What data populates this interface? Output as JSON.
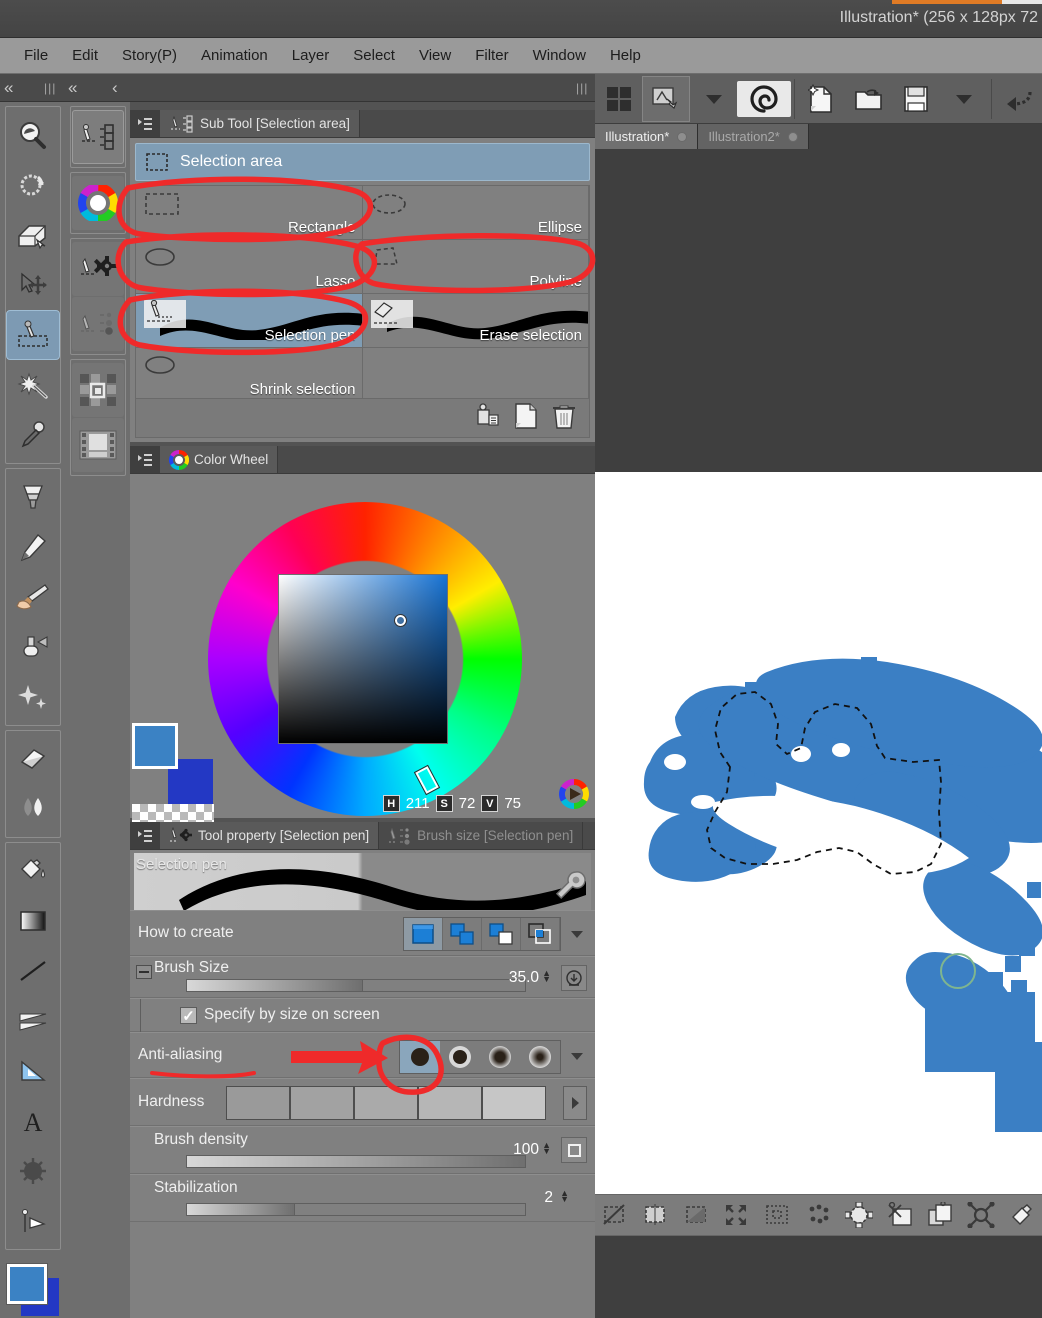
{
  "window": {
    "title": "Illustration* (256 x 128px 72"
  },
  "menu": {
    "items": [
      "File",
      "Edit",
      "Story(P)",
      "Animation",
      "Layer",
      "Select",
      "View",
      "Filter",
      "Window",
      "Help"
    ]
  },
  "toolbar": {
    "buttons": [
      {
        "name": "grid-view-icon",
        "label": ""
      },
      {
        "name": "tool-switch-icon",
        "label": ""
      },
      {
        "name": "chevron-down-icon",
        "label": ""
      },
      {
        "name": "clip-studio-logo-icon",
        "label": ""
      },
      {
        "name": "new-file-icon",
        "label": ""
      },
      {
        "name": "open-file-icon",
        "label": ""
      },
      {
        "name": "save-icon",
        "label": ""
      },
      {
        "name": "chevron-down-icon-2",
        "label": ""
      },
      {
        "name": "undo-icon",
        "label": ""
      }
    ]
  },
  "document_tabs": [
    {
      "label": "Illustration*",
      "active": true
    },
    {
      "label": "Illustration2*",
      "active": false
    }
  ],
  "tool_palette": {
    "groups": [
      [
        "magnifier-tool",
        "rotate-tool",
        "move-tool",
        "object-select-tool",
        "selection-area-tool",
        "magic-wand-tool",
        "eyedropper-tool"
      ],
      [
        "fill-gradient-tool",
        "pen-tool",
        "brush-tool",
        "airbrush-tool",
        "decoration-tool"
      ],
      [
        "eraser-tool",
        "blend-tool"
      ],
      [
        "paint-bucket-tool",
        "gradient-tool",
        "line-tool",
        "figure-tool",
        "ruler-tool",
        "text-tool",
        "balloon-tool",
        "frame-border-tool"
      ]
    ],
    "selected": "selection-area-tool"
  },
  "palette_icons": {
    "items": [
      "sub-tool-palette-icon",
      "color-wheel-palette-icon",
      "tool-property-palette-icon",
      "brush-size-palette-icon",
      "material-palette-icon",
      "timeline-palette-icon"
    ]
  },
  "sub_tool_panel": {
    "tab_label": "Sub Tool [Selection area]",
    "group_header": "Selection area",
    "tools": [
      {
        "label": "Rectangle",
        "icon": "rectangle-select-icon",
        "selected": false
      },
      {
        "label": "Ellipse",
        "icon": "ellipse-select-icon",
        "selected": false
      },
      {
        "label": "Lasso",
        "icon": "lasso-select-icon",
        "selected": false
      },
      {
        "label": "Polyline",
        "icon": "polyline-select-icon",
        "selected": false
      },
      {
        "label": "Selection pen",
        "icon": "selection-pen-icon",
        "selected": true
      },
      {
        "label": "Erase selection",
        "icon": "erase-selection-icon",
        "selected": false
      },
      {
        "label": "Shrink selection",
        "icon": "shrink-selection-icon",
        "selected": false
      }
    ],
    "footer_buttons": [
      "duplicate-sub-tool-icon",
      "create-sub-tool-icon",
      "delete-sub-tool-icon"
    ]
  },
  "color_wheel_panel": {
    "tab_label": "Color Wheel",
    "hsv": {
      "h_key": "H",
      "h": "211",
      "s_key": "S",
      "s": "72",
      "v_key": "V",
      "v": "75"
    },
    "colors": {
      "foreground": "#3b82c4",
      "background": "#2338c4"
    }
  },
  "tool_property_panel": {
    "tab_label": "Tool property [Selection pen]",
    "tab_label_inactive": "Brush size [Selection pen]",
    "preview_name": "Selection pen",
    "rows": {
      "how_to_create": {
        "label": "How to create",
        "modes": [
          "create-selection-mode",
          "add-selection-mode",
          "subtract-selection-mode",
          "intersect-selection-mode"
        ],
        "selected_index": 0
      },
      "brush_size": {
        "label": "Brush Size",
        "value": "35.0",
        "fill_percent": 52
      },
      "specify_by_size": {
        "label": "Specify by size on screen",
        "checked": true
      },
      "anti_aliasing": {
        "label": "Anti-aliasing",
        "options": [
          "none",
          "low",
          "medium",
          "high"
        ],
        "selected_index": 0
      },
      "hardness": {
        "label": "Hardness",
        "swatches": 5
      },
      "brush_density": {
        "label": "Brush density",
        "value": "100",
        "fill_percent": 100
      },
      "stabilization": {
        "label": "Stabilization",
        "value": "2",
        "fill_percent": 32
      }
    }
  },
  "selection_launcher": {
    "buttons": [
      "deselect-icon",
      "select-all-icon",
      "invert-selection-icon",
      "expand-selection-icon",
      "shrink-selection-icon",
      "dots-icon",
      "blur-selection-icon",
      "cut-paste-icon",
      "copy-paste-icon",
      "scale-rotate-icon",
      "fill-selection-icon"
    ]
  },
  "annotations": {
    "circles": [
      "rectangle-lasso-circle",
      "polyline-circle",
      "selection-pen-circle",
      "anti-aliasing-circle"
    ],
    "arrow": "anti-aliasing-arrow",
    "underline": "anti-aliasing-underline"
  }
}
